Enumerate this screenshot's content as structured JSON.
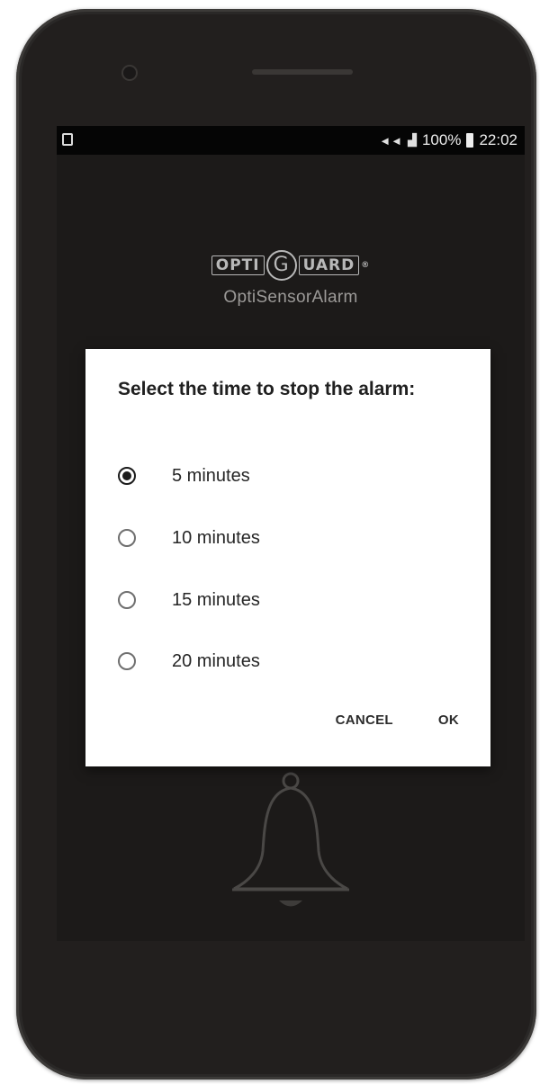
{
  "status_bar": {
    "battery_percent": "100%",
    "time": "22:02",
    "icons": [
      "screenshot-icon",
      "mute-icon",
      "signal-icon",
      "battery-icon"
    ]
  },
  "brand": {
    "logo_parts": [
      "OPTI",
      "G",
      "UARD"
    ],
    "app_name": "OptiSensorAlarm"
  },
  "dialog": {
    "title": "Select the time to stop the alarm:",
    "options": [
      {
        "label": "5 minutes",
        "selected": true
      },
      {
        "label": "10 minutes",
        "selected": false
      },
      {
        "label": "15 minutes",
        "selected": false
      },
      {
        "label": "20 minutes",
        "selected": false
      }
    ],
    "cancel_label": "CANCEL",
    "ok_label": "OK"
  },
  "colors": {
    "screen_background": "#1c1a19",
    "dialog_background": "#ffffff",
    "phone_body": "#2a2827"
  }
}
